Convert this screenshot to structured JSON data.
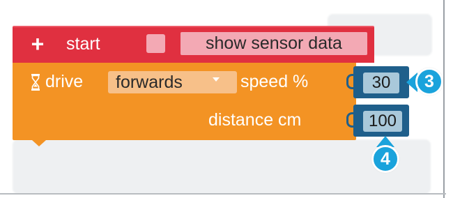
{
  "start_block": {
    "label": "start",
    "plus_glyph": "+",
    "checkbox_checked": false,
    "sensor_label": "show sensor data",
    "color": "#e03040"
  },
  "drive_block": {
    "label": "drive",
    "icon": "hourglass-icon",
    "direction": "forwards",
    "speed_label": "speed %",
    "distance_label": "distance cm",
    "color": "#f39324"
  },
  "speed_value": "30",
  "distance_value": "100",
  "callouts": {
    "speed": "3",
    "distance": "4",
    "color": "#1aa3dc"
  },
  "number_block_color": "#1f5f8b"
}
